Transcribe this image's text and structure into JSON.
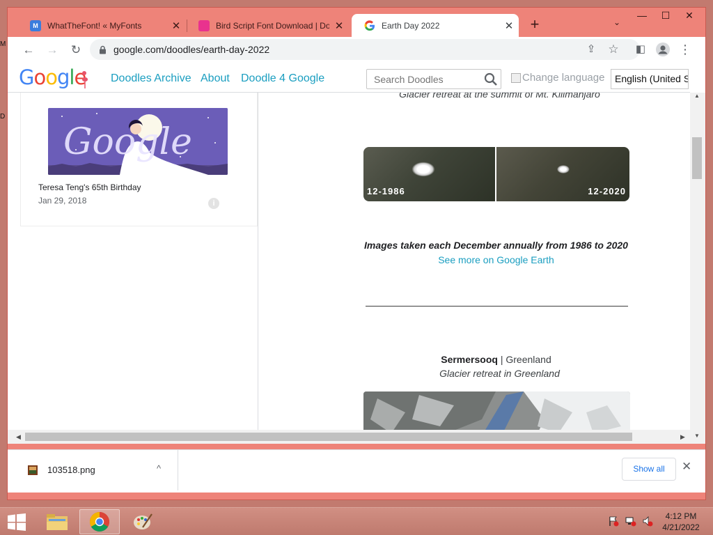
{
  "desktop": {
    "edge_text_top": "M",
    "edge_text_mid": "D"
  },
  "window": {
    "minimize": "—",
    "maximize": "☐",
    "close": "✕"
  },
  "tabs": [
    {
      "title": "WhatTheFont! « MyFonts",
      "close": "✕"
    },
    {
      "title": "Bird Script Font Download | Dow",
      "close": "✕"
    },
    {
      "title": "Earth Day 2022",
      "close": "✕"
    }
  ],
  "tabstrip": {
    "new_tab": "+",
    "tab_search": "⌄"
  },
  "toolbar": {
    "back": "←",
    "forward": "→",
    "reload": "↻",
    "url": "google.com/doodles/earth-day-2022",
    "share": "⇪",
    "bookmark": "☆",
    "sidepanel": "◧",
    "menu": "⋮"
  },
  "header": {
    "logo": "Google",
    "nav": [
      "Doodles Archive",
      "About",
      "Doodle 4 Google"
    ],
    "search_placeholder": "Search Doodles",
    "change_language": "Change language",
    "language": "English (United States)"
  },
  "sidebar": {
    "doodle_logo_text": "Google",
    "doodle_title": "Teresa Teng's 65th Birthday",
    "doodle_date": "Jan 29, 2018",
    "info": "i"
  },
  "main": {
    "caption_top": "Glacier retreat at the summit of Mt. Kilimanjaro",
    "compare_left": "12-1986",
    "compare_right": "12-2020",
    "note": "Images taken each December annually from 1986 to 2020",
    "see_more": "See more on Google Earth",
    "place_name": "Sermersooq",
    "place_sep": " | ",
    "place_region": "Greenland",
    "caption_bottom": "Glacier retreat in Greenland"
  },
  "scroll": {
    "up": "▲",
    "down": "▼",
    "left": "◀",
    "right": "▶"
  },
  "downloads": {
    "file": "103518.png",
    "chevron": "^",
    "show_all": "Show all",
    "close": "✕"
  },
  "taskbar": {
    "time": "4:12 PM",
    "date": "4/21/2022"
  },
  "colors": {
    "accent": "#1a9ec0",
    "window_frame": "#ee8379",
    "doodle_bg": "#6d5fbd"
  }
}
